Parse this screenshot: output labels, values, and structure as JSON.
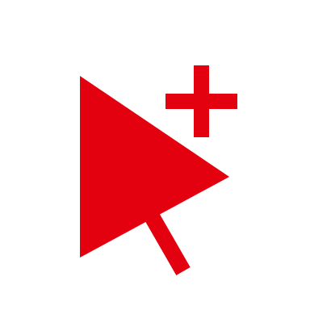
{
  "icon": {
    "name": "add-cursor-icon",
    "background_color": "#ffffff",
    "accent_color": "#e3000f",
    "parts": [
      "cursor-arrow",
      "cursor-tail",
      "plus-sign"
    ]
  }
}
